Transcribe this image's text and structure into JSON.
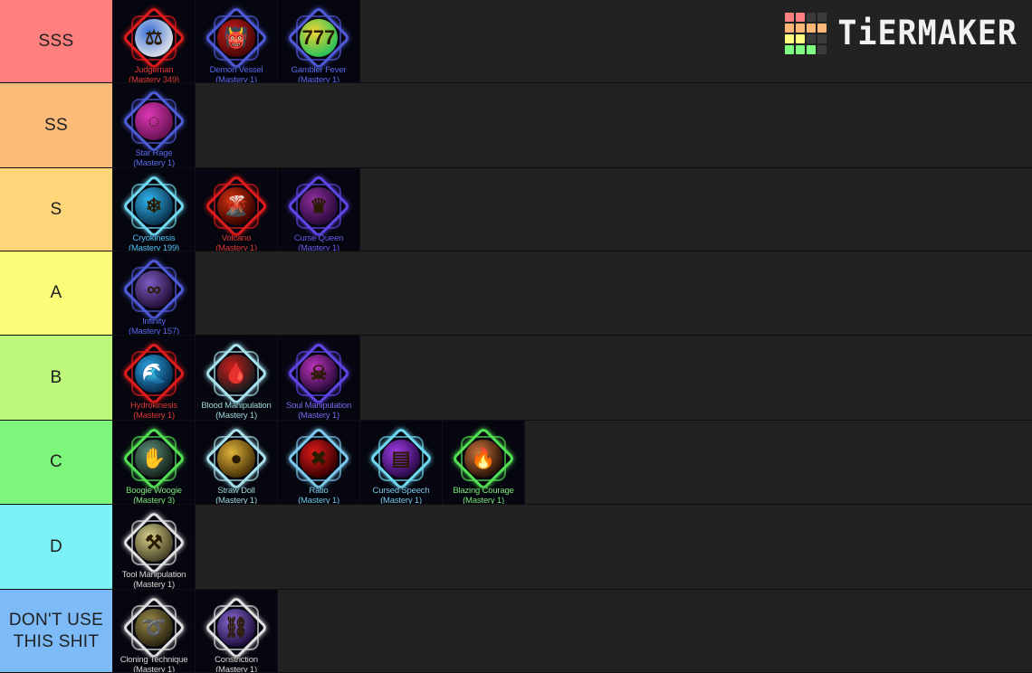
{
  "logo": {
    "brand": "TiERMAKER",
    "grid_colors": [
      [
        "#fd8080",
        "#fd8080",
        "#3b3b3b",
        "#3b3b3b"
      ],
      [
        "#fcb779",
        "#fcb779",
        "#fcb779",
        "#fcb779"
      ],
      [
        "#fdfd80",
        "#fdfd80",
        "#3b3b3b",
        "#3b3b3b"
      ],
      [
        "#80fd80",
        "#80fd80",
        "#80fd80",
        "#3b3b3b"
      ]
    ]
  },
  "tiers": [
    {
      "label": "SSS",
      "color": "#ff7f7f",
      "height": 92,
      "items": [
        {
          "name": "Judgeman",
          "mastery": "(Mastery 349)",
          "text_color": "#e03a3a",
          "frame": "#e01b1b",
          "orb_a": "#3b6fd8",
          "orb_b": "#d8dde6",
          "glyph": "⚖"
        },
        {
          "name": "Demon Vessel",
          "mastery": "(Mastery 1)",
          "text_color": "#5b6bf0",
          "frame": "#4f5bd8",
          "orb_a": "#c91a1a",
          "orb_b": "#4a0707",
          "glyph": "👹"
        },
        {
          "name": "Gambler Fever",
          "mastery": "(Mastery 1)",
          "text_color": "#5b6bf0",
          "frame": "#4f5bd8",
          "orb_a": "#f2d232",
          "orb_b": "#2fc45a",
          "glyph": "777"
        }
      ]
    },
    {
      "label": "SS",
      "color": "#fcbb79",
      "height": 94,
      "items": [
        {
          "name": "Star Rage",
          "mastery": "(Mastery 1)",
          "text_color": "#5b6bf0",
          "frame": "#4f5bd8",
          "orb_a": "#e038b8",
          "orb_b": "#6a1254",
          "glyph": "◌"
        }
      ]
    },
    {
      "label": "S",
      "color": "#fcd679",
      "height": 92,
      "items": [
        {
          "name": "Cryokinesis",
          "mastery": "(Mastery 199)",
          "text_color": "#4fc3f7",
          "frame": "#6fd8f2",
          "orb_a": "#31b7f0",
          "orb_b": "#0a3452",
          "glyph": "❄"
        },
        {
          "name": "Volcano",
          "mastery": "(Mastery 1)",
          "text_color": "#e03a3a",
          "frame": "#e01b1b",
          "orb_a": "#d63210",
          "orb_b": "#3a0400",
          "glyph": "🌋"
        },
        {
          "name": "Curse Queen",
          "mastery": "(Mastery 1)",
          "text_color": "#6b5bf0",
          "frame": "#6046e8",
          "orb_a": "#8e2f9e",
          "orb_b": "#2a0a3a",
          "glyph": "♛"
        }
      ]
    },
    {
      "label": "A",
      "color": "#fcfc79",
      "height": 93,
      "items": [
        {
          "name": "Infinity",
          "mastery": "(Mastery 157)",
          "text_color": "#5b6bf0",
          "frame": "#4f5bd8",
          "orb_a": "#7a5cc4",
          "orb_b": "#251038",
          "glyph": "∞"
        }
      ]
    },
    {
      "label": "B",
      "color": "#bdf77c",
      "height": 94,
      "items": [
        {
          "name": "Hydrokinesis",
          "mastery": "(Mastery 1)",
          "text_color": "#e03a3a",
          "frame": "#e01b1b",
          "orb_a": "#29a8e8",
          "orb_b": "#0a2f52",
          "glyph": "🌊"
        },
        {
          "name": "Blood Manipulation",
          "mastery": "(Mastery 1)",
          "text_color": "#9fd8df",
          "frame": "#a8e2ee",
          "orb_a": "#cc1c1c",
          "orb_b": "#1c1c1c",
          "glyph": "🩸"
        },
        {
          "name": "Soul Manipulation",
          "mastery": "(Mastery 1)",
          "text_color": "#7a6bf0",
          "frame": "#6046e8",
          "orb_a": "#c033c0",
          "orb_b": "#2a0a3a",
          "glyph": "☠"
        }
      ]
    },
    {
      "label": "C",
      "color": "#7cf77c",
      "height": 93,
      "items": [
        {
          "name": "Boogie Woogie",
          "mastery": "(Mastery 3)",
          "text_color": "#7ce87c",
          "frame": "#54e054",
          "orb_a": "#5c8f7a",
          "orb_b": "#16251c",
          "glyph": "✋"
        },
        {
          "name": "Straw Doll",
          "mastery": "(Mastery 1)",
          "text_color": "#9fd8df",
          "frame": "#a8e2ee",
          "orb_a": "#e0b43a",
          "orb_b": "#4a3408",
          "glyph": "●"
        },
        {
          "name": "Ratio",
          "mastery": "(Mastery 1)",
          "text_color": "#6fc8e8",
          "frame": "#7cc8ee",
          "orb_a": "#e01b1b",
          "orb_b": "#3a0000",
          "glyph": "✖"
        },
        {
          "name": "Cursed Speech",
          "mastery": "(Mastery 1)",
          "text_color": "#7cc8ee",
          "frame": "#6fd8f2",
          "orb_a": "#a03ce8",
          "orb_b": "#2a0a4a",
          "glyph": "▤"
        },
        {
          "name": "Blazing Courage",
          "mastery": "(Mastery 1)",
          "text_color": "#7ce87c",
          "frame": "#54e054",
          "orb_a": "#c9743a",
          "orb_b": "#2a1408",
          "glyph": "🔥"
        }
      ]
    },
    {
      "label": "D",
      "color": "#7cf2f7",
      "height": 94,
      "items": [
        {
          "name": "Tool Manipulation",
          "mastery": "(Mastery 1)",
          "text_color": "#d8d8d8",
          "frame": "#e0e0e0",
          "orb_a": "#d6cf8a",
          "orb_b": "#4a4528",
          "glyph": "⚒"
        }
      ]
    },
    {
      "label": "DON'T USE THIS SHIT",
      "color": "#7cbbf7",
      "height": 92,
      "items": [
        {
          "name": "Cloning Technique",
          "mastery": "(Mastery 1)",
          "text_color": "#d8d8d8",
          "frame": "#e0e0e0",
          "orb_a": "#9a8a4a",
          "orb_b": "#2a2510",
          "glyph": "➰"
        },
        {
          "name": "Constriction",
          "mastery": "(Mastery 1)",
          "text_color": "#d8d8d8",
          "frame": "#e0e0e0",
          "orb_a": "#8a6ad8",
          "orb_b": "#201040",
          "glyph": "⛓"
        }
      ]
    }
  ]
}
